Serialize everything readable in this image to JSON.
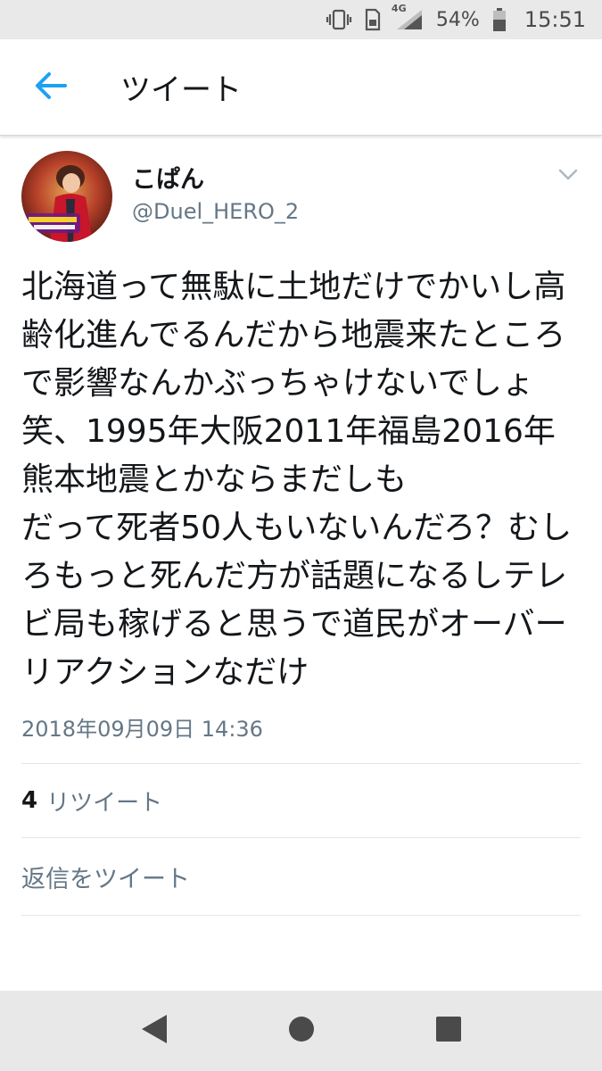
{
  "status_bar": {
    "network": "4G",
    "battery_percent": "54%",
    "time": "15:51"
  },
  "header": {
    "title": "ツイート"
  },
  "tweet": {
    "display_name": "こぱん",
    "handle": "@Duel_HERO_2",
    "text": "北海道って無駄に土地だけでかいし高齢化進んでるんだから地震来たところで影響なんかぶっちゃけないでしょ笑、1995年大阪2011年福島2016年熊本地震とかならまだしも\nだって死者50人もいないんだろ？むしろもっと死んだ方が話題になるしテレビ局も稼げると思うで道民がオーバーリアクションなだけ",
    "timestamp": "2018年09月09日 14:36",
    "retweet_count": "4",
    "retweet_label": "リツイート"
  },
  "reply": {
    "placeholder": "返信をツイート"
  },
  "colors": {
    "accent": "#1da1f2",
    "secondary_text": "#657786",
    "status_bar_bg": "#e9e9e9",
    "nav_bar_bg": "#e8e8e8"
  },
  "icons": {
    "back": "arrow-left-icon",
    "caret": "chevron-down-icon",
    "nav_back": "triangle-back-icon",
    "nav_home": "circle-home-icon",
    "nav_recents": "square-recents-icon"
  }
}
